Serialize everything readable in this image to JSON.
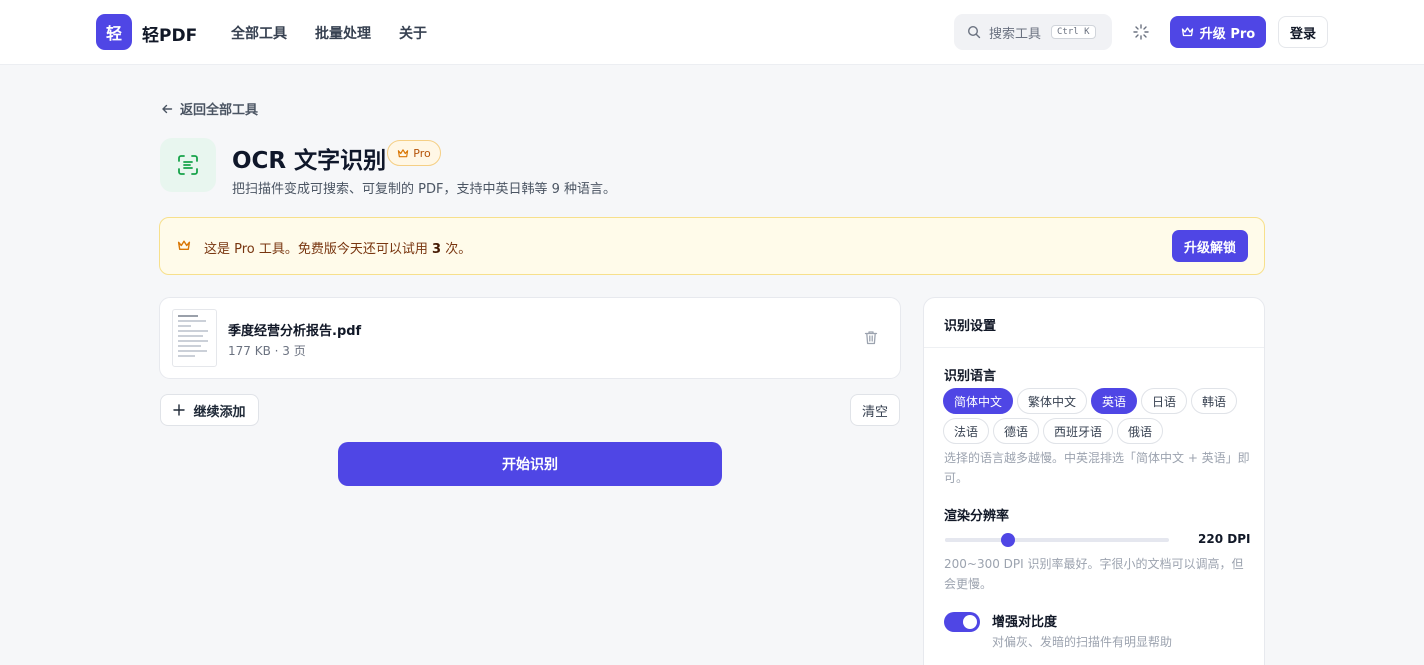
{
  "header": {
    "logo_char": "轻",
    "brand": "轻PDF",
    "nav": [
      "全部工具",
      "批量处理",
      "关于"
    ],
    "search_placeholder": "搜索工具",
    "search_shortcut": "Ctrl K",
    "upgrade_label": "升级 Pro",
    "login_label": "登录"
  },
  "page": {
    "back_label": "返回全部工具",
    "title": "OCR 文字识别",
    "badge": "Pro",
    "description": "把扫描件变成可搜索、可复制的 PDF，支持中英日韩等 9 种语言。"
  },
  "banner": {
    "text_before": "这是 Pro 工具。免费版今天还可以试用 ",
    "count": "3",
    "text_after": " 次。",
    "button_label": "升级解锁"
  },
  "file": {
    "name": "季度经营分析报告.pdf",
    "meta": "177 KB · 3 页"
  },
  "actions": {
    "add_label": "继续添加",
    "clear_label": "清空",
    "start_label": "开始识别"
  },
  "settings": {
    "title": "识别设置",
    "language_label": "识别语言",
    "languages": [
      {
        "label": "简体中文",
        "selected": true
      },
      {
        "label": "繁体中文",
        "selected": false
      },
      {
        "label": "英语",
        "selected": true
      },
      {
        "label": "日语",
        "selected": false
      },
      {
        "label": "韩语",
        "selected": false
      },
      {
        "label": "法语",
        "selected": false
      },
      {
        "label": "德语",
        "selected": false
      },
      {
        "label": "西班牙语",
        "selected": false
      },
      {
        "label": "俄语",
        "selected": false
      }
    ],
    "language_hint": "选择的语言越多越慢。中英混排选「简体中文 + 英语」即可。",
    "resolution_label": "渲染分辨率",
    "dpi_value": 220,
    "dpi_text": "220 DPI",
    "dpi_min": 72,
    "dpi_max": 600,
    "resolution_hint": "200~300 DPI 识别率最好。字很小的文档可以调高，但会更慢。",
    "contrast_label": "增强对比度",
    "contrast_enabled": true,
    "contrast_hint": "对偏灰、发暗的扫描件有明显帮助"
  },
  "colors": {
    "accent": "#4f46e5",
    "pro": "#d97706",
    "tool_icon": "#16a34a"
  }
}
